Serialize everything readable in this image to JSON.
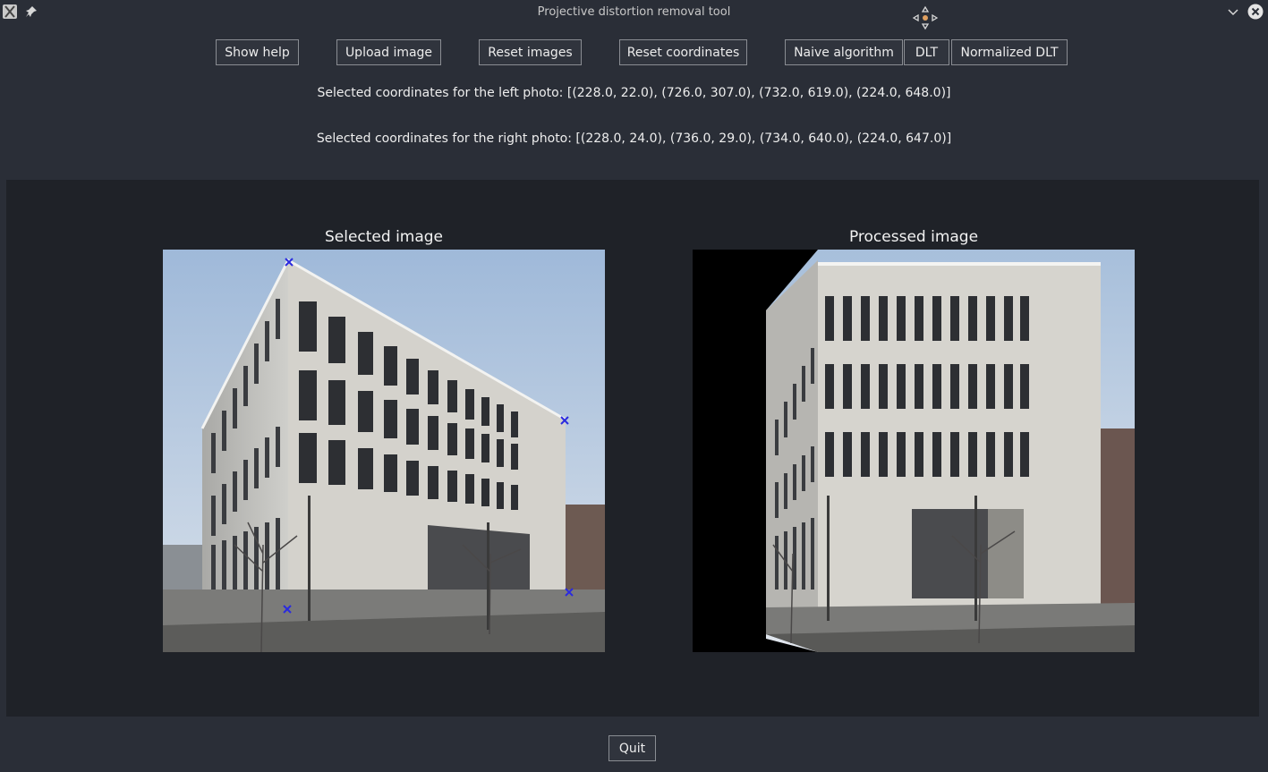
{
  "window": {
    "title": "Projective distortion removal tool",
    "app_icon": "x-app-icon",
    "pin_icon": "pin-icon",
    "move_icon": "move-icon",
    "minimize_icon": "chevron-down-icon",
    "close_icon": "close-icon"
  },
  "toolbar": {
    "show_help": "Show help",
    "upload_image": "Upload image",
    "reset_images": "Reset images",
    "reset_coordinates": "Reset coordinates",
    "naive_algorithm": "Naive algorithm",
    "dlt": "DLT",
    "normalized_dlt": "Normalized DLT"
  },
  "coordinates": {
    "left": "Selected coordinates for the left photo: [(228.0, 22.0), (726.0, 307.0), (732.0, 619.0), (224.0, 648.0)]",
    "right": "Selected coordinates for the right photo: [(228.0, 24.0), (736.0, 29.0), (734.0, 640.0), (224.0, 647.0)]"
  },
  "images": {
    "selected_title": "Selected image",
    "processed_title": "Processed image"
  },
  "footer": {
    "quit": "Quit"
  },
  "colors": {
    "background": "#2a2e37",
    "panel": "#1f2228",
    "marker": "#2a2adf"
  }
}
